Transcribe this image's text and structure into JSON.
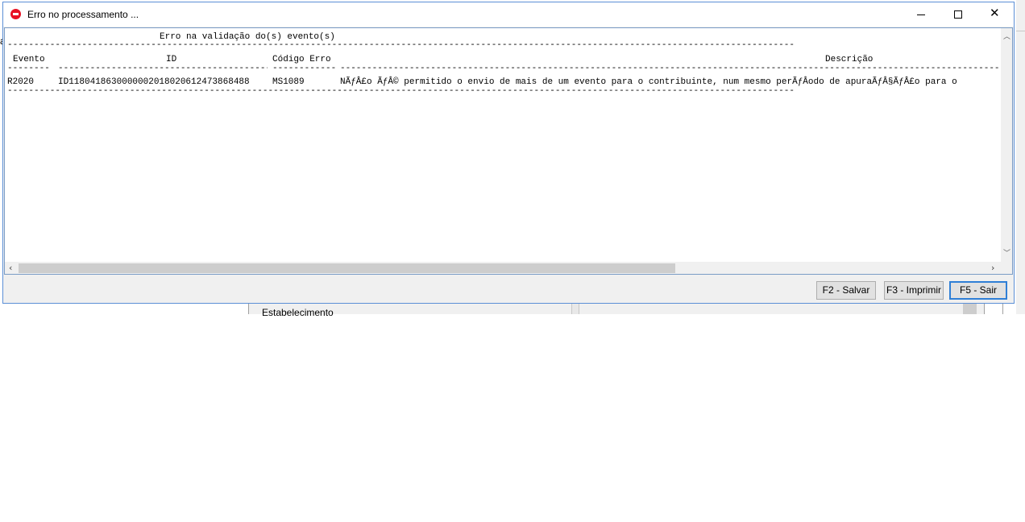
{
  "window": {
    "title": "Erro no processamento ...",
    "icon": "stop-error-icon",
    "close_glyph": "✕"
  },
  "report": {
    "heading": "Erro na validação do(s) evento(s)",
    "columns": {
      "evento": "Evento",
      "id": "ID",
      "codigo": "Código Erro",
      "descricao": "Descrição"
    },
    "rows": [
      {
        "evento": "R2020",
        "id": "ID1180418630000002018020612473868488",
        "codigo": "MS1089",
        "descricao": "NÃƒÂ£o ÃƒÂ© permitido o envio de mais de um evento para o contribuinte, num mesmo perÃƒÂ­odo de apuraÃƒÂ§ÃƒÂ£o para o"
      }
    ]
  },
  "buttons": {
    "save": "F2 - Salvar",
    "print": "F3 - Imprimir",
    "exit": "F5 - Sair"
  },
  "background": {
    "panel_label": "Estabelecimento",
    "left_glyph": "a"
  },
  "colors": {
    "accent": "#2f7fd6",
    "error_icon": "#e81123"
  }
}
